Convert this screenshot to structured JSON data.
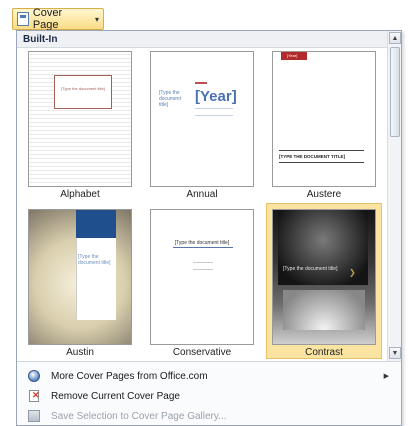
{
  "toolbar": {
    "cover_page_label": "Cover Page"
  },
  "gallery": {
    "section_title": "Built-In",
    "items": [
      {
        "name": "Alphabet",
        "preview_text": "[Type the document title]"
      },
      {
        "name": "Annual",
        "preview_title": "[Type the document title]",
        "preview_year": "[Year]"
      },
      {
        "name": "Austere",
        "preview_year": "[Year]",
        "preview_title": "[TYPE THE DOCUMENT TITLE]"
      },
      {
        "name": "Austin",
        "preview_title": "[Type the document title]"
      },
      {
        "name": "Conservative",
        "preview_title": "[Type the document title]"
      },
      {
        "name": "Contrast",
        "preview_title": "[Type the document title]",
        "selected": true
      }
    ]
  },
  "menu": {
    "items": [
      {
        "label": "More Cover Pages from Office.com",
        "icon": "globe-icon",
        "has_submenu": true,
        "enabled": true
      },
      {
        "label": "Remove Current Cover Page",
        "icon": "remove-document-icon",
        "has_submenu": false,
        "enabled": true
      },
      {
        "label": "Save Selection to Cover Page Gallery...",
        "icon": "save-icon",
        "has_submenu": false,
        "enabled": false
      }
    ]
  },
  "colors": {
    "accent": "#fbe4a2",
    "header": "#1c2b46"
  }
}
